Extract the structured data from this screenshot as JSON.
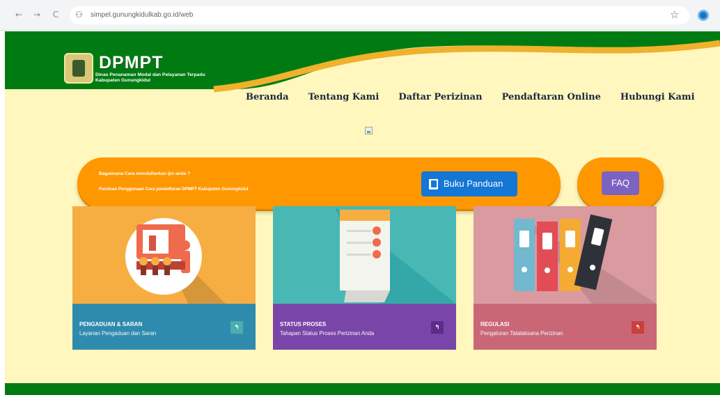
{
  "browser": {
    "back_icon": "←",
    "forward_icon": "→",
    "reload_icon": "C",
    "url": "simpel.gunungkidulkab.go.id/web",
    "site_info_icon": "⚇",
    "bookmark_icon": "☆"
  },
  "site": {
    "logo_title": "DPMPT",
    "logo_subtitle_line1": "Dinas Penanaman Modal dan Pelayanan Terpadu",
    "logo_subtitle_line2": "Kabupaten Gunungkidul"
  },
  "menu": {
    "items": [
      "Beranda",
      "Tentang Kami",
      "Daftar Perizinan",
      "Pendaftaran Online",
      "Hubungi Kami"
    ]
  },
  "info_panel": {
    "question": "Bagaimana Cara mendaftarkan ijin anda ?",
    "guide": "Panduan Penggunaan Cara pendaftaran DPMPT Kabupaten Gunungkidul",
    "buku_button": "Buku Panduan",
    "faq_button": "FAQ"
  },
  "cards": [
    {
      "title": "PENGADUAN & SARAN",
      "description": "Layanan Pengaduan dan Saran",
      "art_color": "#f6ae43",
      "footer_color": "#2f8bae",
      "button_color": "#4aaeae",
      "circle_color": "#ffffff"
    },
    {
      "title": "STATUS PROSES",
      "description": "Tahapan Status Proses Perizinan Anda",
      "art_color": "#49b8b5",
      "footer_color": "#7a45a8",
      "button_color": "#5c2c8a",
      "circle_color": "#2a9fa3"
    },
    {
      "title": "REGULASI",
      "description": "Pengaturan Tatalaksana Perizinan",
      "art_color": "#d99aa0",
      "footer_color": "#ca6777",
      "button_color": "#c9403d",
      "circle_color": "#e0a6ac"
    }
  ],
  "arrow_icon": "↰"
}
